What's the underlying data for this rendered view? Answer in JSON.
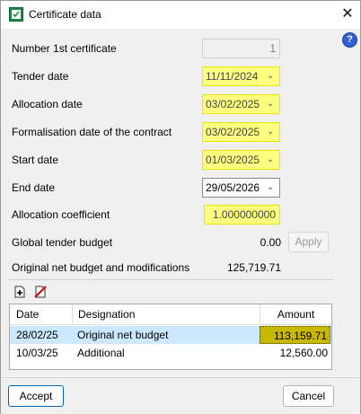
{
  "window": {
    "title": "Certificate data"
  },
  "fields": {
    "number_label": "Number 1st certificate",
    "number_value": "1",
    "tender_label": "Tender date",
    "tender_value": "11/11/2024",
    "allocation_label": "Allocation date",
    "allocation_value": "03/02/2025",
    "formalisation_label": "Formalisation date of the contract",
    "formalisation_value": "03/02/2025",
    "start_label": "Start date",
    "start_value": "01/03/2025",
    "end_label": "End date",
    "end_value": "29/05/2026",
    "coef_label": "Allocation coefficient",
    "coef_value": "1.000000000",
    "global_label": "Global tender budget",
    "global_value": "0.00",
    "apply_label": "Apply",
    "original_label": "Original net budget and modifications",
    "original_value": "125,719.71"
  },
  "table": {
    "headers": {
      "date": "Date",
      "designation": "Designation",
      "amount": "Amount"
    },
    "rows": [
      {
        "date": "28/02/25",
        "designation": "Original net budget",
        "amount": "113,159.71"
      },
      {
        "date": "10/03/25",
        "designation": "Additional",
        "amount": "12,560.00"
      }
    ]
  },
  "buttons": {
    "accept": "Accept",
    "cancel": "Cancel"
  },
  "icons": {
    "app": "certificate-app-icon",
    "close": "close-icon",
    "help": "help-icon",
    "add": "add-row-icon",
    "delete": "delete-row-icon"
  },
  "colors": {
    "highlight_yellow": "#ffff80",
    "selected_row": "#cce8ff",
    "help_blue": "#2f5fd0",
    "delete_red": "#d00000"
  }
}
